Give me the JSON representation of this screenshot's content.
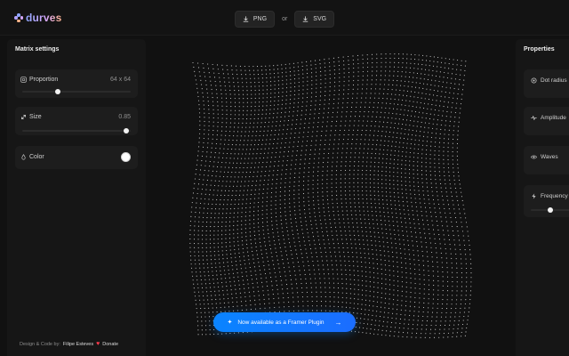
{
  "app": {
    "name": "durves",
    "brand_gradient": [
      "#8ea6ff",
      "#d7a8ff",
      "#ffb489"
    ]
  },
  "toolbar": {
    "png_label": "PNG",
    "or_label": "or",
    "svg_label": "SVG"
  },
  "left_panel": {
    "title": "Matrix settings",
    "proportion": {
      "label": "Proportion",
      "value": "64 x 64",
      "slider_fraction": 0.33
    },
    "size": {
      "label": "Size",
      "value": "0.85",
      "slider_fraction": 0.96
    },
    "color": {
      "label": "Color",
      "swatch": "#ffffff"
    }
  },
  "right_panel": {
    "title": "Properties",
    "items": [
      {
        "label": "Dot radius",
        "icon": "target-icon"
      },
      {
        "label": "Amplitude",
        "icon": "pulse-icon"
      },
      {
        "label": "Waves",
        "icon": "eye-icon"
      },
      {
        "label": "Frequency",
        "icon": "bolt-icon"
      }
    ]
  },
  "footer": {
    "credit": "Design & Code by:",
    "author": "Filipe Esteves",
    "donate": "Donate"
  },
  "cta": {
    "label": "Now available as a Framer Plugin",
    "accent": "#0a84ff"
  },
  "matrix": {
    "rows": 64,
    "cols": 64,
    "dot_color": "#d9d9d9"
  }
}
